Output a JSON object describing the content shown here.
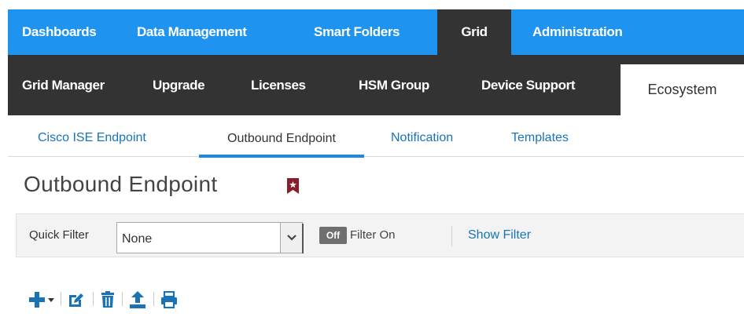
{
  "topnav": {
    "items": [
      {
        "label": "Dashboards"
      },
      {
        "label": "Data Management"
      },
      {
        "label": "Smart Folders"
      },
      {
        "label": "Grid"
      },
      {
        "label": "Administration"
      }
    ]
  },
  "subnav": {
    "items": [
      {
        "label": "Grid Manager"
      },
      {
        "label": "Upgrade"
      },
      {
        "label": "Licenses"
      },
      {
        "label": "HSM Group"
      },
      {
        "label": "Device Support"
      },
      {
        "label": "Ecosystem"
      }
    ]
  },
  "tabs": {
    "items": [
      {
        "label": "Cisco ISE Endpoint"
      },
      {
        "label": "Outbound Endpoint"
      },
      {
        "label": "Notification"
      },
      {
        "label": "Templates"
      }
    ]
  },
  "page": {
    "title": "Outbound Endpoint"
  },
  "filter": {
    "quick_filter_label": "Quick Filter",
    "quick_filter_value": "None",
    "toggle_label": "Off",
    "filter_on_label": "Filter On",
    "show_filter_label": "Show Filter"
  },
  "colors": {
    "topnav_bg": "#1e93f0",
    "subnav_bg": "#333333",
    "link": "#1a73b5",
    "icon_blue": "#1a73b5",
    "bookmark": "#8b1c2c"
  },
  "toolbar": {
    "icons": [
      "add-icon",
      "dropdown-caret-icon",
      "edit-icon",
      "delete-icon",
      "upload-icon",
      "print-icon"
    ]
  }
}
